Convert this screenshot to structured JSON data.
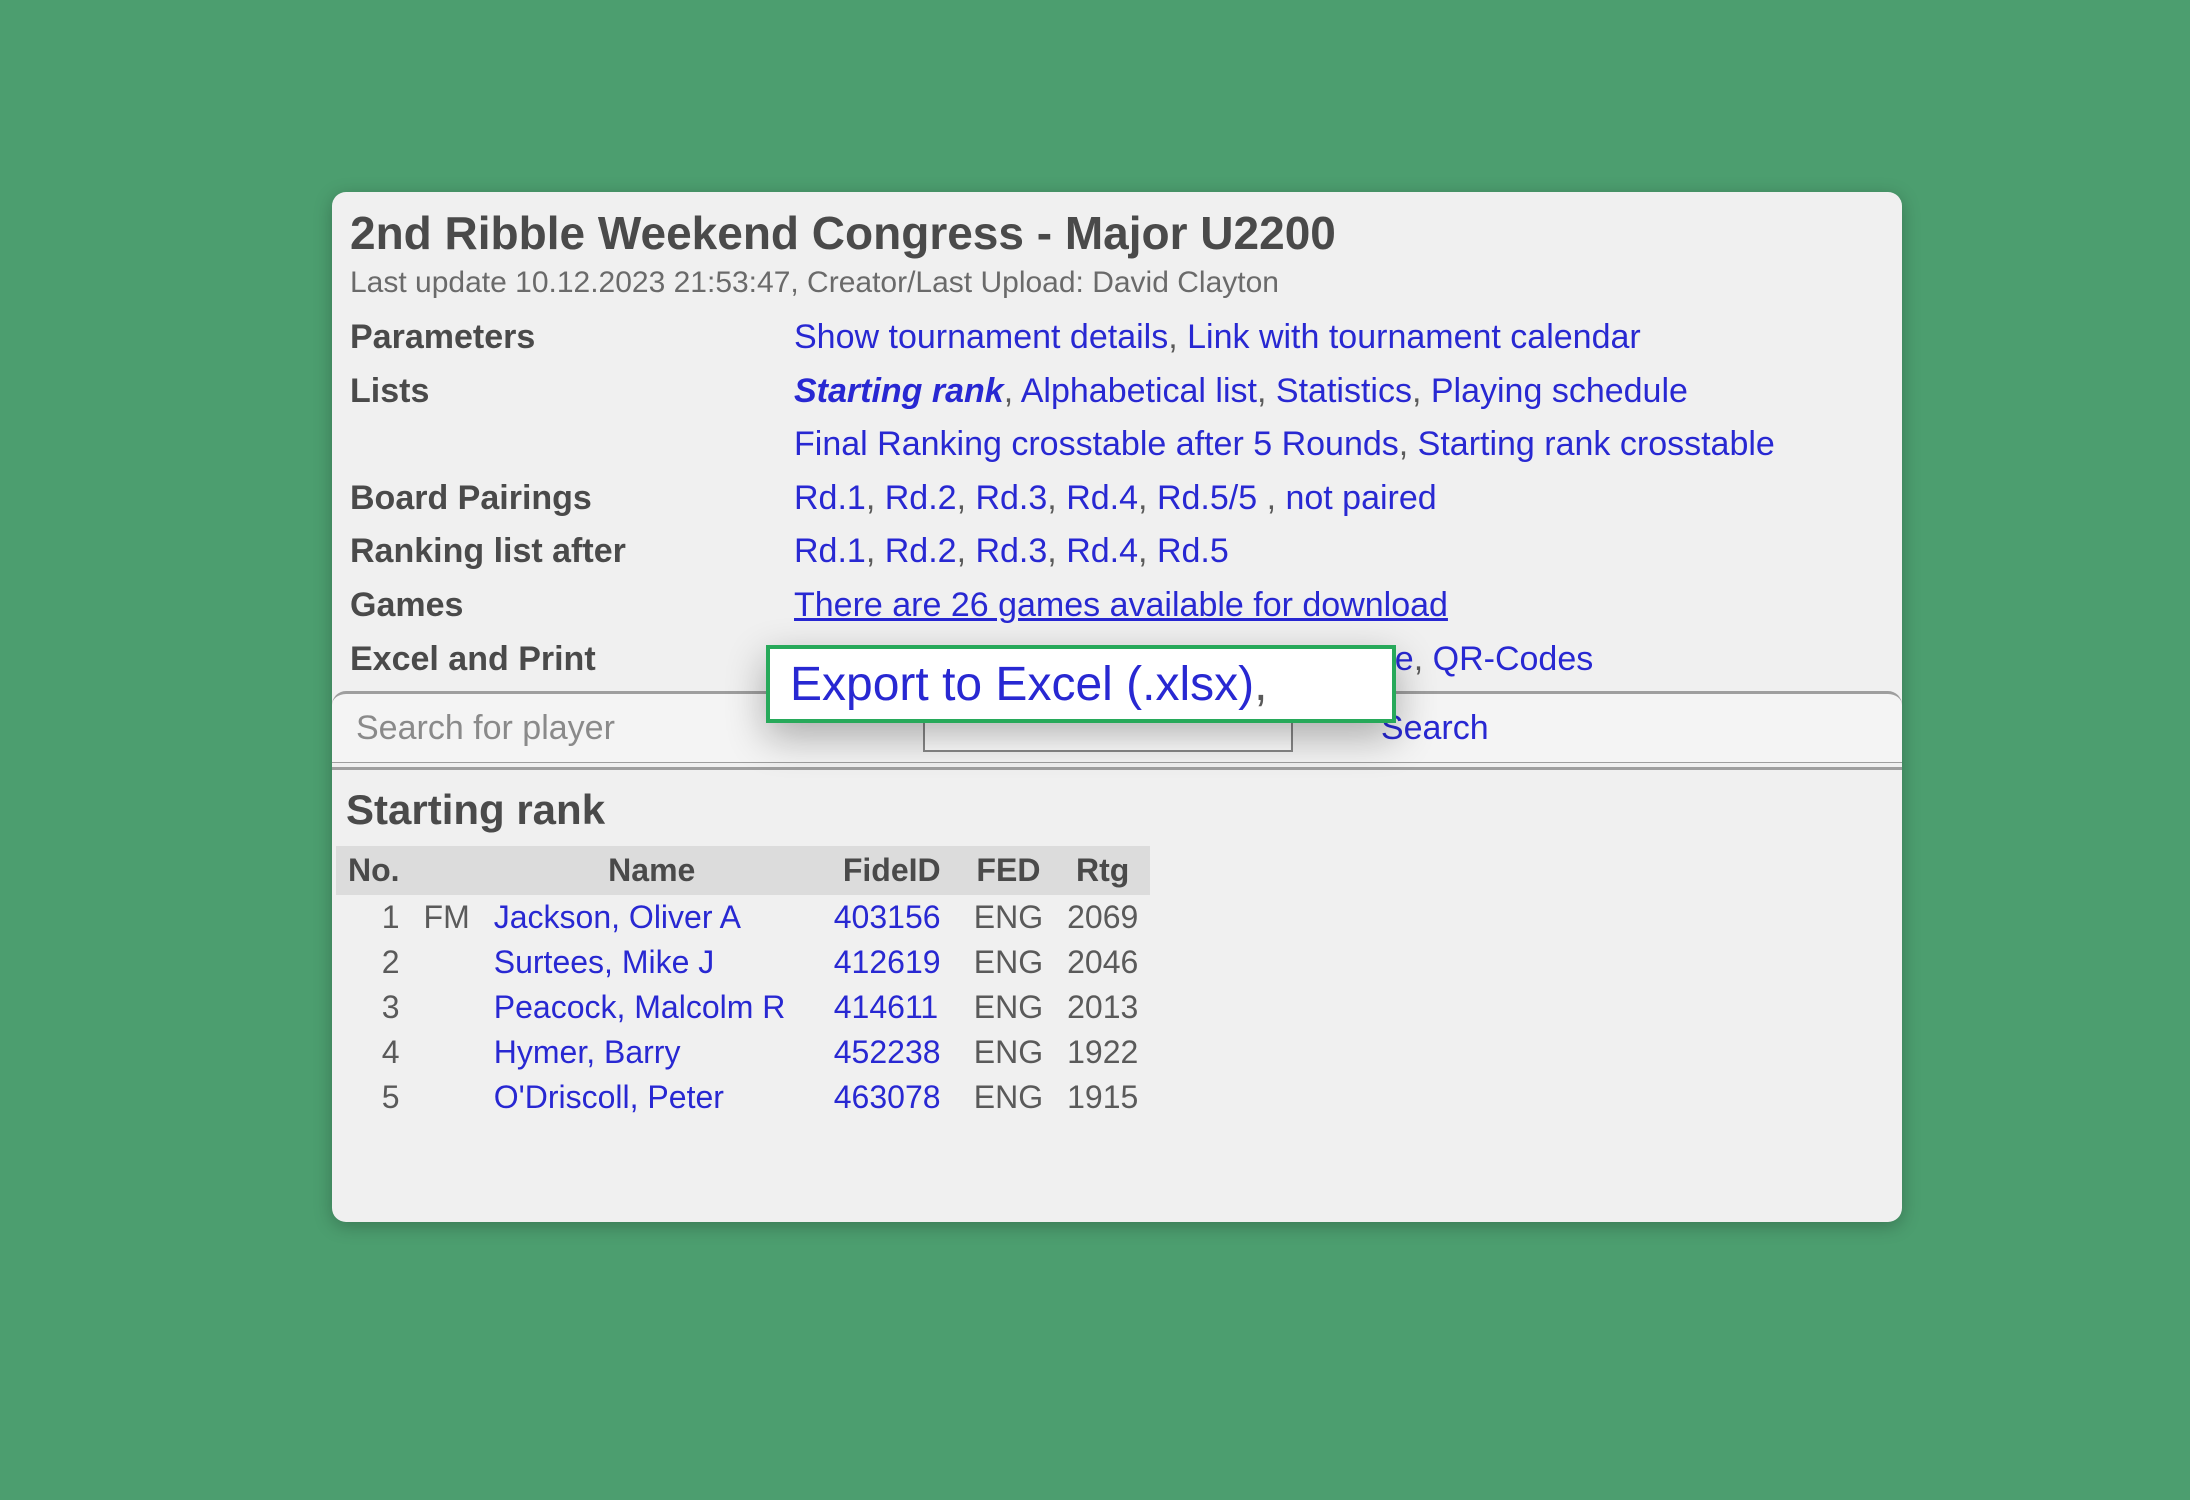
{
  "header": {
    "title": "2nd Ribble Weekend Congress - Major U2200",
    "subtitle": "Last update 10.12.2023 21:53:47, Creator/Last Upload: David Clayton"
  },
  "meta": {
    "parameters": {
      "label": "Parameters",
      "links": [
        "Show tournament details",
        "Link with tournament calendar"
      ]
    },
    "lists": {
      "label": "Lists",
      "starting_rank": "Starting rank",
      "links1": [
        "Alphabetical list",
        "Statistics",
        "Playing schedule"
      ],
      "links2": [
        "Final Ranking crosstable after 5 Rounds",
        "Starting rank crosstable"
      ]
    },
    "board_pairings": {
      "label": "Board Pairings",
      "links": [
        "Rd.1",
        "Rd.2",
        "Rd.3",
        "Rd.4",
        "Rd.5/5"
      ],
      "not_paired": "not paired"
    },
    "ranking_after": {
      "label": "Ranking list after",
      "links": [
        "Rd.1",
        "Rd.2",
        "Rd.3",
        "Rd.4",
        "Rd.5"
      ]
    },
    "games": {
      "label": "Games",
      "link": "There are 26 games available for download"
    },
    "excel": {
      "label": "Excel and Print",
      "tail_frag": "le",
      "qr": "QR-Codes"
    }
  },
  "search": {
    "label": "Search for player",
    "button": "Search"
  },
  "highlight": {
    "text": "Export to Excel (.xlsx)",
    "comma": ","
  },
  "table": {
    "title": "Starting rank",
    "headers": {
      "no": "No.",
      "title": "",
      "name": "Name",
      "fideid": "FideID",
      "fed": "FED",
      "rtg": "Rtg"
    },
    "rows": [
      {
        "no": "1",
        "title": "FM",
        "name": "Jackson, Oliver A",
        "fideid": "403156",
        "fed": "ENG",
        "rtg": "2069"
      },
      {
        "no": "2",
        "title": "",
        "name": "Surtees, Mike J",
        "fideid": "412619",
        "fed": "ENG",
        "rtg": "2046"
      },
      {
        "no": "3",
        "title": "",
        "name": "Peacock, Malcolm R",
        "fideid": "414611",
        "fed": "ENG",
        "rtg": "2013"
      },
      {
        "no": "4",
        "title": "",
        "name": "Hymer, Barry",
        "fideid": "452238",
        "fed": "ENG",
        "rtg": "1922"
      },
      {
        "no": "5",
        "title": "",
        "name": "O'Driscoll, Peter",
        "fideid": "463078",
        "fed": "ENG",
        "rtg": "1915"
      }
    ]
  }
}
